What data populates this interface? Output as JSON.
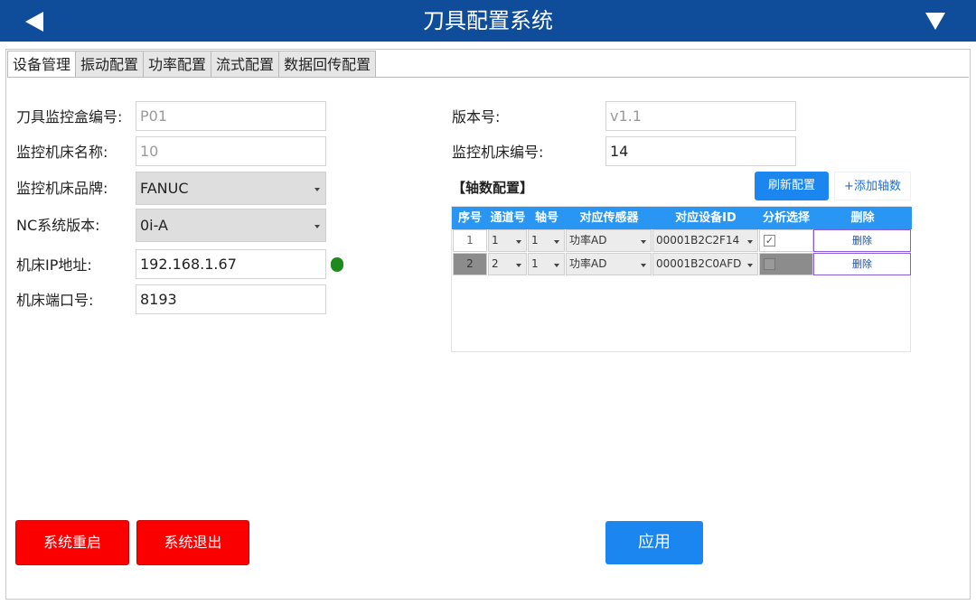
{
  "header": {
    "title": "刀具配置系统",
    "back_icon": "back-arrow-icon",
    "menu_icon": "dropdown-triangle-icon"
  },
  "tabs": [
    {
      "label": "设备管理",
      "active": true
    },
    {
      "label": "振动配置",
      "active": false
    },
    {
      "label": "功率配置",
      "active": false
    },
    {
      "label": "流式配置",
      "active": false
    },
    {
      "label": "数据回传配置",
      "active": false
    }
  ],
  "form": {
    "box_id_label": "刀具监控盒编号:",
    "box_id_value": "P01",
    "machine_name_label": "监控机床名称:",
    "machine_name_value": "10",
    "brand_label": "监控机床品牌:",
    "brand_value": "FANUC",
    "nc_version_label": "NC系统版本:",
    "nc_version_value": "0i-A",
    "ip_label": "机床IP地址:",
    "ip_value": "192.168.1.67",
    "ip_status_color": "#1e8a1e",
    "port_label": "机床端口号:",
    "port_value": "8193",
    "version_label": "版本号:",
    "version_value": "v1.1",
    "machine_no_label": "监控机床编号:",
    "machine_no_value": "14"
  },
  "axis": {
    "section_title": "【轴数配置】",
    "refresh_label": "刷新配置",
    "add_label": "+添加轴数",
    "columns": [
      "序号",
      "通道号",
      "轴号",
      "对应传感器",
      "对应设备ID",
      "分析选择",
      "删除"
    ],
    "rows": [
      {
        "index": "1",
        "channel": "1",
        "axis": "1",
        "sensor": "功率AD",
        "device_id": "00001B2C2F14",
        "analysis": true,
        "delete_label": "删除"
      },
      {
        "index": "2",
        "channel": "2",
        "axis": "1",
        "sensor": "功率AD",
        "device_id": "00001B2C0AFD",
        "analysis": false,
        "delete_label": "删除"
      }
    ]
  },
  "actions": {
    "restart_label": "系统重启",
    "exit_label": "系统退出",
    "apply_label": "应用"
  },
  "colors": {
    "header_bg": "#0f4d9a",
    "accent_blue": "#1b86f0",
    "danger_red": "#fb0000"
  }
}
